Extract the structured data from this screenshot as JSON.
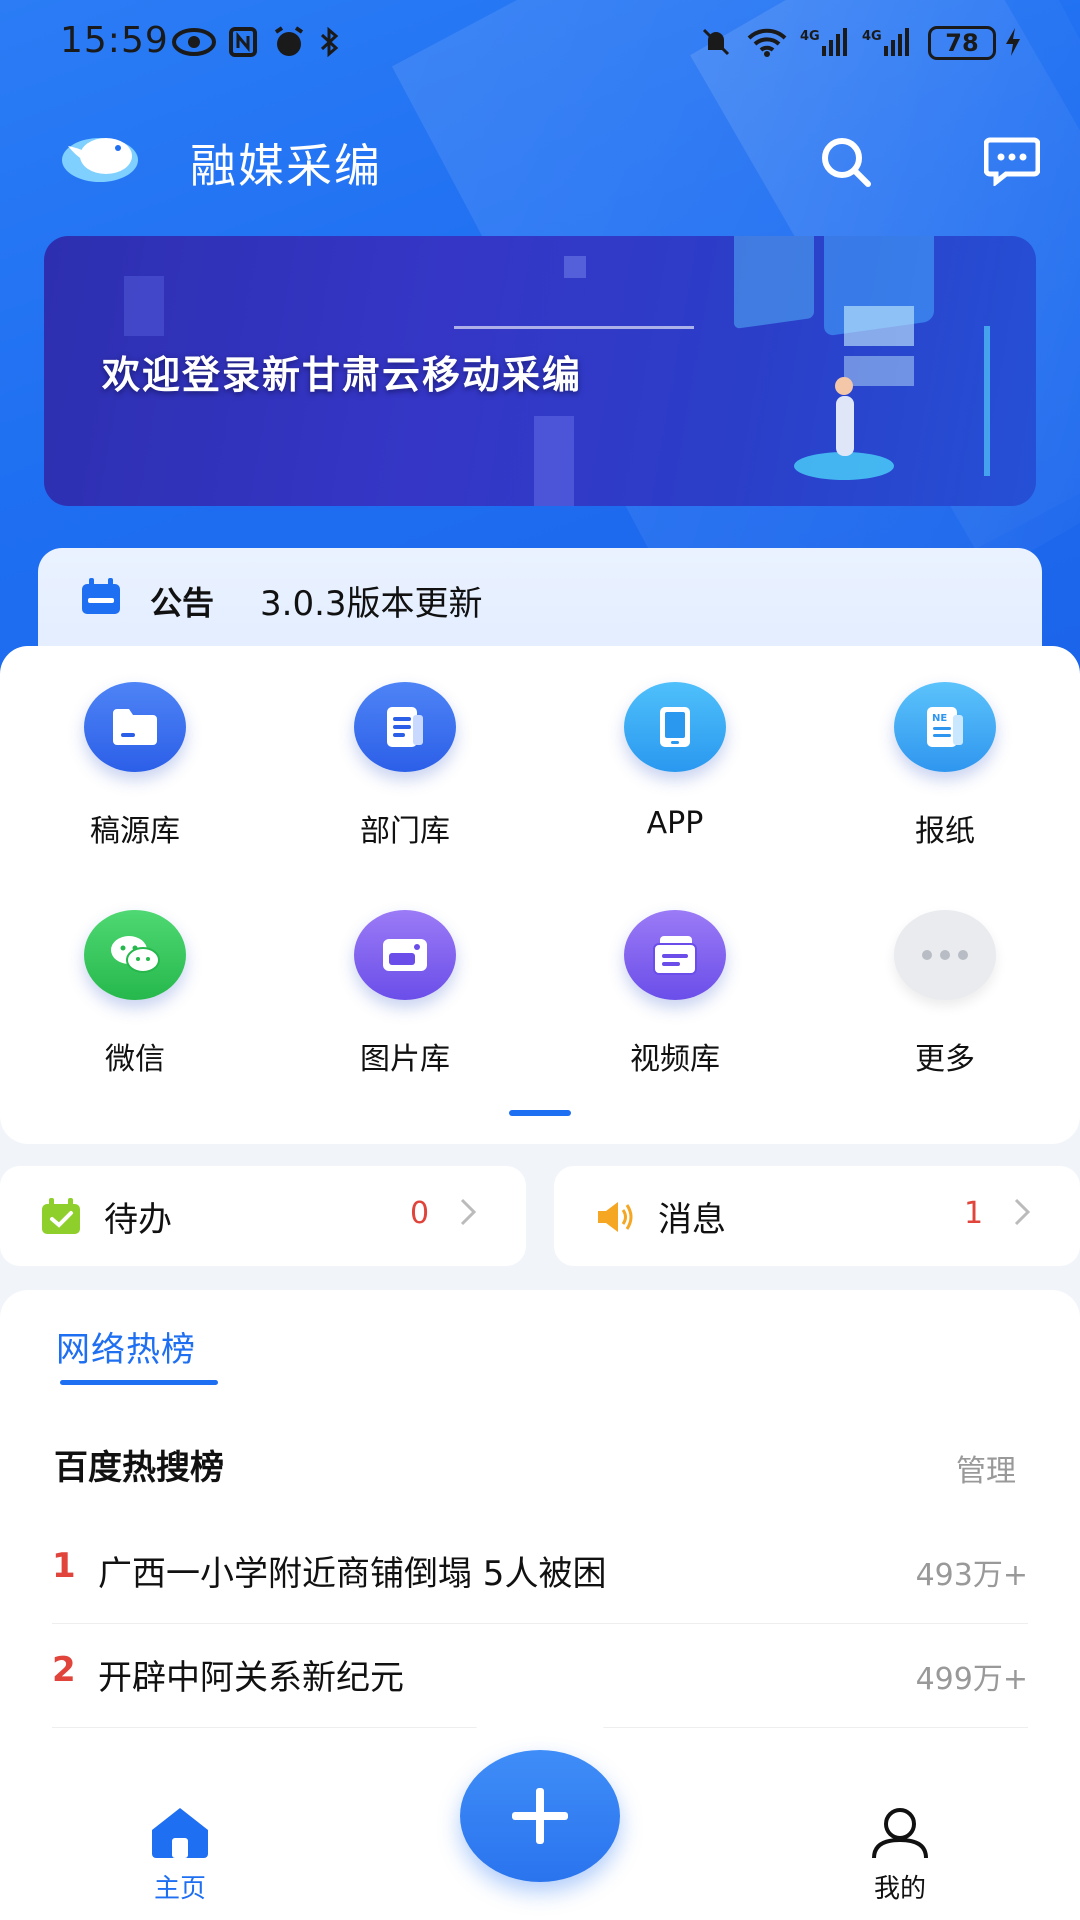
{
  "status_bar": {
    "time": "15:59",
    "battery": "78"
  },
  "header": {
    "title": "融媒采编"
  },
  "banner": {
    "text": "欢迎登录新甘肃云移动采编"
  },
  "notice": {
    "label": "公告",
    "text": "3.0.3版本更新"
  },
  "grid": [
    {
      "label": "稿源库",
      "icon": "folder-icon",
      "color": "#2f66f0"
    },
    {
      "label": "部门库",
      "icon": "document-icon",
      "color": "#2f66f0"
    },
    {
      "label": "APP",
      "icon": "tablet-icon",
      "color": "#2fa6f5"
    },
    {
      "label": "报纸",
      "icon": "newspaper-icon",
      "color": "#3aa4f3"
    },
    {
      "label": "微信",
      "icon": "wechat-icon",
      "color": "#33c75a"
    },
    {
      "label": "图片库",
      "icon": "image-icon",
      "color": "#7a5cf0"
    },
    {
      "label": "视频库",
      "icon": "video-library-icon",
      "color": "#7a5cf0"
    },
    {
      "label": "更多",
      "icon": "more-icon",
      "color": "#e9ebef"
    }
  ],
  "todo": {
    "label": "待办",
    "count": "0"
  },
  "messages": {
    "label": "消息",
    "count": "1"
  },
  "hot": {
    "tab": "网络热榜",
    "title": "百度热搜榜",
    "manage": "管理",
    "items": [
      {
        "rank": "1",
        "text": "广西一小学附近商铺倒塌 5人被困",
        "value": "493万+"
      },
      {
        "rank": "2",
        "text": "开辟中阿关系新纪元",
        "value": "499万+"
      }
    ]
  },
  "nav": {
    "home": "主页",
    "me": "我的"
  },
  "colors": {
    "primary": "#1f6ff2",
    "accent_red": "#e0443a"
  }
}
